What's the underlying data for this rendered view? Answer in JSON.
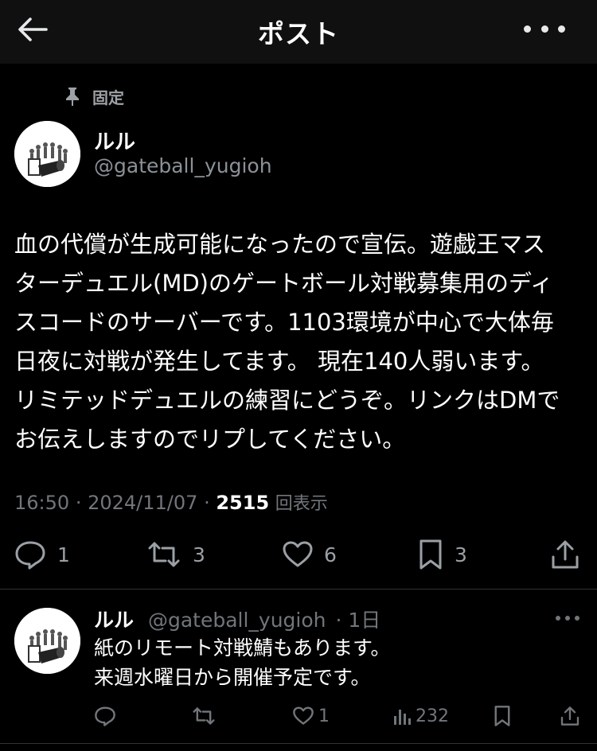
{
  "header": {
    "title": "ポスト",
    "back_icon": "arrow-left-icon",
    "more_icon": "more-horizontal-icon"
  },
  "pinned": {
    "label": "固定",
    "icon": "pin-icon"
  },
  "post": {
    "author_name": "ルル",
    "author_handle": "@gateball_yugioh",
    "text": "血の代償が生成可能になったので宣伝。遊戯王マス\nターデュエル(MD)のゲートボール対戦募集用のディ\nスコードのサーバーです。1103環境が中心で大体毎\n日夜に対戦が発生してます。 現在140人弱います。\nリミテッドデュエルの練習にどうぞ。リンクはDMで\nお伝えしますのでリプしてください。",
    "time": "16:50",
    "date": "2024/11/07",
    "separator": "·",
    "views": "2515",
    "views_label": "回表示",
    "actions": {
      "replies": "1",
      "reposts": "3",
      "likes": "6",
      "bookmarks": "3"
    }
  },
  "reply": {
    "author_name": "ルル",
    "author_handle": "@gateball_yugioh",
    "age": "· 1日",
    "text": "紙のリモート対戦鯖もあります。\n来週水曜日から開催予定です。",
    "likes": "1",
    "views": "232"
  },
  "colors": {
    "background": "#000000",
    "header_bg": "#101010",
    "text_primary": "#ffffff",
    "text_secondary": "#71767b",
    "divider": "#2f3336"
  }
}
